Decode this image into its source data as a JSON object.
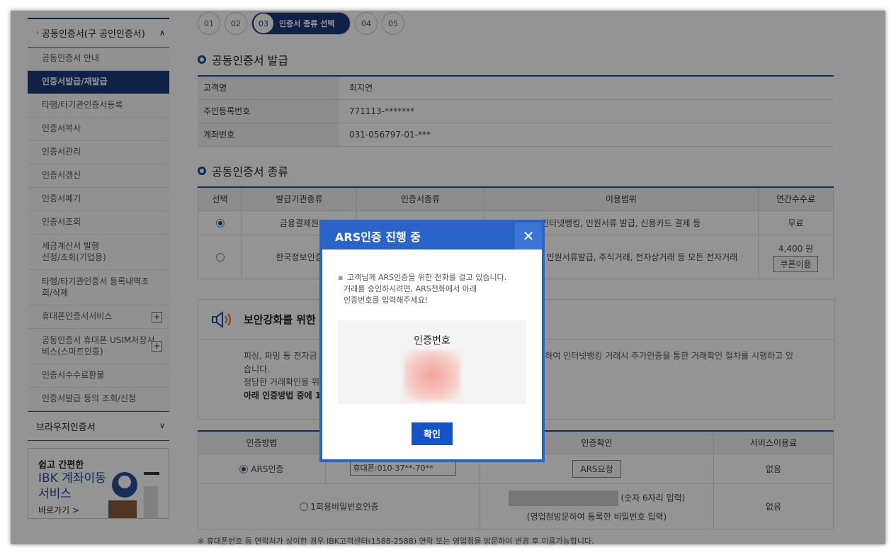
{
  "sidebar": {
    "section_title": "공동인증서(구 공인인증서)",
    "items": [
      {
        "label": "공동인증서 안내"
      },
      {
        "label": "인증서발급/재발급"
      },
      {
        "label": "타행/타기관인증서등록"
      },
      {
        "label": "인증서복사"
      },
      {
        "label": "인증서관리"
      },
      {
        "label": "인증서갱신"
      },
      {
        "label": "인증서폐기"
      },
      {
        "label": "인증서조회"
      },
      {
        "label": "세금계산서 발행\n신청/조회(기업용)"
      },
      {
        "label": "타행/타기관인증서 등록내역조\n회/삭제"
      },
      {
        "label": "휴대폰인증서서비스"
      },
      {
        "label": "공동인증서 휴대폰 USIM저장서\n비스(스마트인증)"
      },
      {
        "label": "인증서수수료환불"
      },
      {
        "label": "인증서발급 등의 조회/신청"
      }
    ],
    "browser_cert": "브라우저인증서",
    "banner": {
      "line1": "쉽고 간편한",
      "line2": "IBK 계좌이동",
      "line3": "서비스",
      "link": "바로가기 >"
    }
  },
  "steps": {
    "s1": "01",
    "s2": "02",
    "s3": "03",
    "s3_label": "인증서 종류 선택",
    "s4": "04",
    "s5": "05"
  },
  "issue": {
    "title": "공동인증서 발급",
    "rows": [
      {
        "k": "고객명",
        "v": "최지연"
      },
      {
        "k": "주민등록번호",
        "v": "771113-*******"
      },
      {
        "k": "계좌번호",
        "v": "031-056797-01-***"
      }
    ]
  },
  "types": {
    "title": "공동인증서 종류",
    "headers": {
      "select": "선택",
      "issuer": "발급기관종류",
      "kind": "인증서종류",
      "scope": "이용범위",
      "fee": "연간수수료"
    },
    "row1": {
      "issuer": "금융결제원",
      "scope": "인터넷뱅킹, 민원서류 발급, 신용카드 결제 등",
      "fee": "무료"
    },
    "row2": {
      "issuer": "한국정보인증",
      "scope": ", 민원서류발급, 주식거래, 전자상거래 등 모든 전자거래",
      "fee": "4,400 원",
      "coupon": "쿠폰이용"
    }
  },
  "security": {
    "title": "보안강화를 위한",
    "body1": "피싱, 파밍 등 전자금",
    "body1b": "하여 인터넷뱅킹 거래시 추가인증을 통한 거래확인 절차를 시행하고 있",
    "body2": "습니다.",
    "body3": "정당한 거래확인을 위",
    "body4": "아래 인증방법 중에 1"
  },
  "auth": {
    "headers": {
      "method": "인증방법",
      "confirm": "인증확인",
      "fee": "서비스이용료"
    },
    "ars_label": "ARS인증",
    "phone_select": "휴대폰:010-37**-70**",
    "ars_button": "ARS요청",
    "ars_fee": "없음",
    "otp_label": "1회용비밀번호인증",
    "otp_hint": "(숫자 6자리 입력)",
    "otp_hint2": "(영업점방문하여 등록한 비밀번호 입력)",
    "otp_fee": "없음"
  },
  "footnote": "※ 휴대폰번호 등 연락처가 상이한 경우 IBK고객센터(1588-2588) 연락 또는 영업점을 방문하여 변경 후 이용가능합니다.",
  "modal": {
    "title": "ARS인증 진행 중",
    "message_line1": "고객님께 ARS인증을 위한 전화를 걸고 있습니다.",
    "message_line2": "거래를 승인하시려면, ARS전화에서 아래",
    "message_line3": "인증번호를 입력해주세요!",
    "code_label": "인증번호",
    "ok": "확인"
  },
  "colors": {
    "accent": "#1d3a7a",
    "modal": "#2a64c8",
    "button": "#1553c7"
  }
}
